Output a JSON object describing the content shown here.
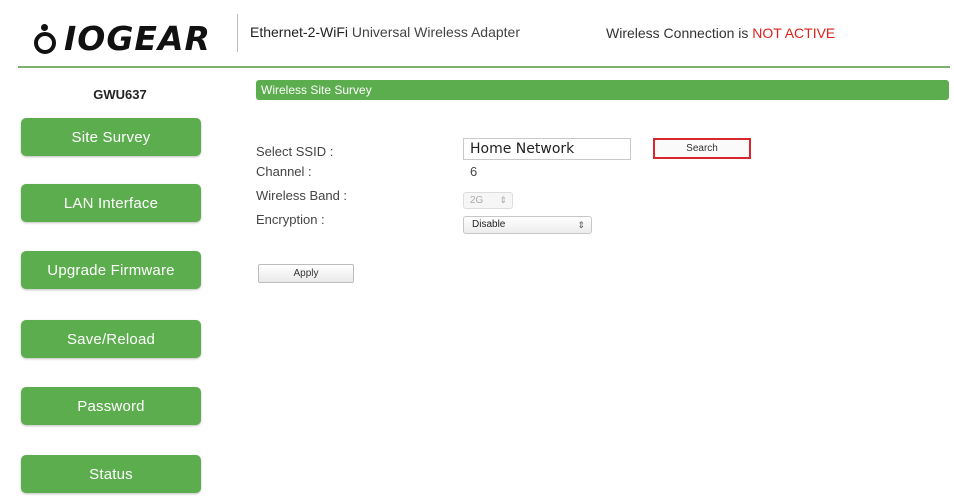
{
  "header": {
    "brand": "IOGEAR",
    "product_bold": "Ethernet-2-WiFi",
    "product_rest": " Universal Wireless Adapter",
    "connection_prefix": "Wireless Connection is ",
    "connection_status": "NOT ACTIVE",
    "status_color": "#e0201a"
  },
  "sidebar": {
    "model": "GWU637",
    "items": [
      {
        "label": "Site Survey"
      },
      {
        "label": "LAN Interface"
      },
      {
        "label": "Upgrade Firmware"
      },
      {
        "label": "Save/Reload"
      },
      {
        "label": "Password"
      },
      {
        "label": "Status"
      }
    ]
  },
  "main": {
    "section_title": "Wireless Site Survey",
    "ssid_label": "Select SSID :",
    "ssid_value": "Home Network",
    "search_label": "Search",
    "channel_label": "Channel :",
    "channel_value": "6",
    "band_label": "Wireless Band :",
    "band_value": "2G",
    "encryption_label": "Encryption :",
    "encryption_value": "Disable",
    "apply_label": "Apply"
  },
  "colors": {
    "accent_green": "#5cad4e",
    "highlight_red": "#d8262c"
  }
}
